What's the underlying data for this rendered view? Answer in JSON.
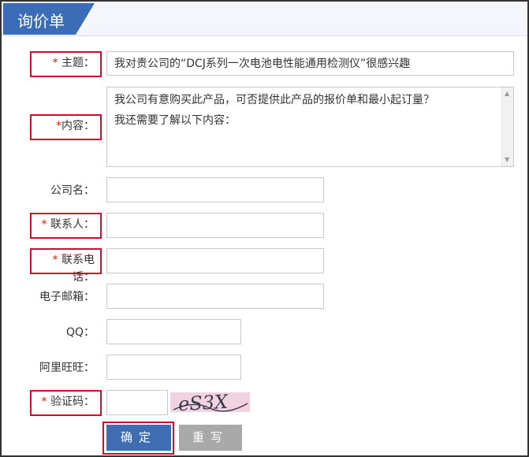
{
  "header": {
    "title": "询价单"
  },
  "form": {
    "subject": {
      "star": "*",
      "label": "主题：",
      "value": "我对贵公司的“DCJ系列一次电池电性能通用检测仪”很感兴趣"
    },
    "content": {
      "star": "*",
      "label": "内容：",
      "lines": [
        "我公司有意购买此产品，可否提供此产品的报价单和最小起订量？",
        "我还需要了解以下内容："
      ]
    },
    "company": {
      "label": "公司名：",
      "value": ""
    },
    "contact": {
      "star": "*",
      "label": "联系人：",
      "value": ""
    },
    "phone": {
      "star": "*",
      "label": "联系电话：",
      "value": ""
    },
    "email": {
      "label": "电子邮箱：",
      "value": ""
    },
    "qq": {
      "label": "QQ：",
      "value": ""
    },
    "aliwangwang": {
      "label": "阿里旺旺：",
      "value": ""
    },
    "captcha": {
      "star": "*",
      "label": "验证码：",
      "value": "",
      "image_text": "eS3X"
    }
  },
  "buttons": {
    "confirm": "确定",
    "reset": "重写"
  },
  "colors": {
    "required_star": "#d81e06",
    "highlight_border": "#c8102e",
    "primary": "#3f6db3",
    "secondary": "#a9a9a9",
    "header_blue": "#3b6cb5"
  },
  "icons": {
    "scroll_up": "triangle-up",
    "scroll_down": "triangle-down"
  }
}
